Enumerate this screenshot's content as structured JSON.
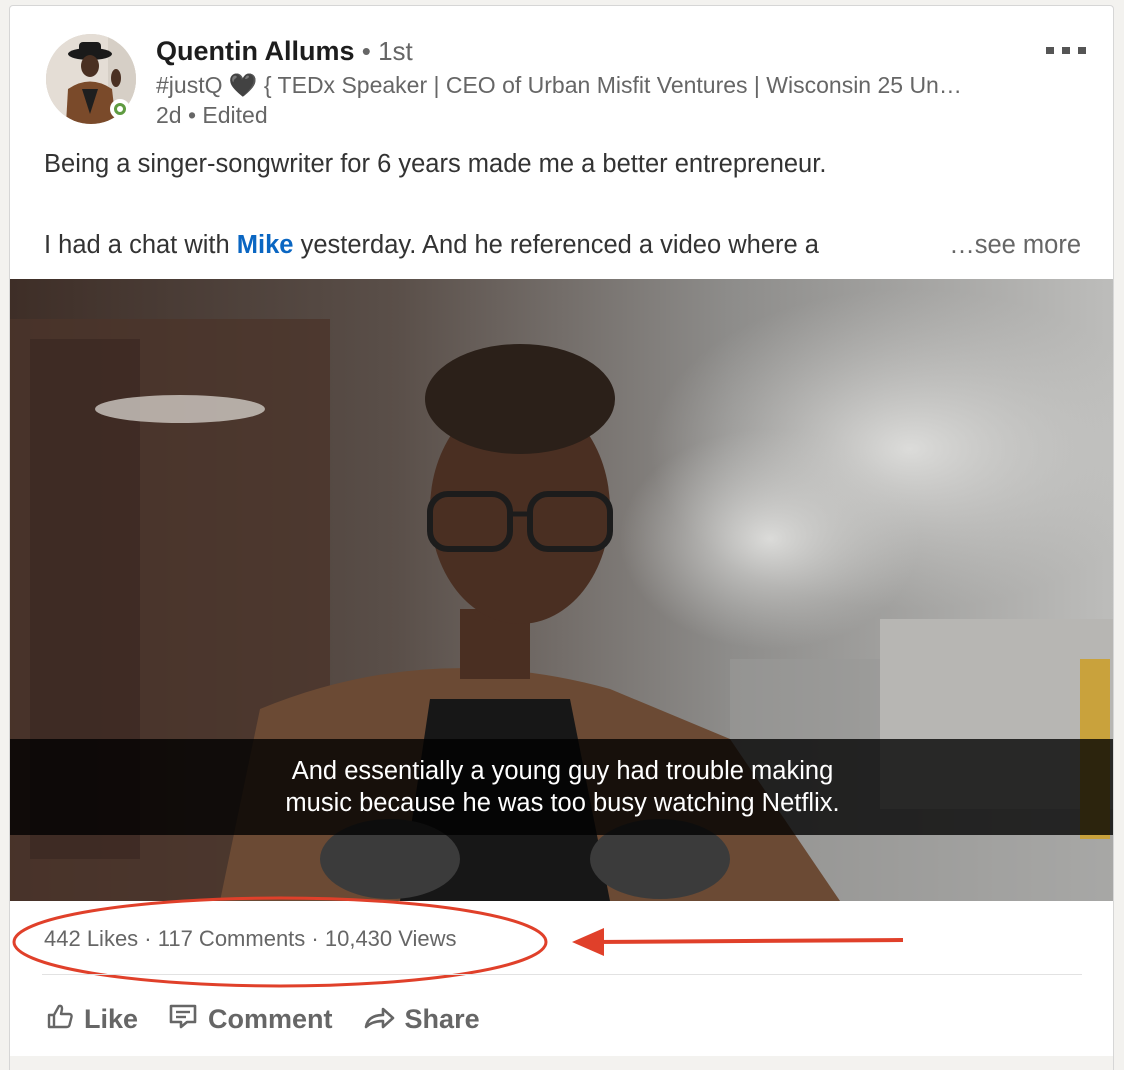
{
  "post": {
    "author": {
      "name": "Quentin Allums",
      "degree": " • 1st",
      "headline": "#justQ 🖤  { TEDx Speaker | CEO of Urban Misfit Ventures | Wisconsin 25 Un…",
      "meta": "2d • Edited",
      "online_status_color": "#5f9b41"
    },
    "text": {
      "line1": "Being a singer-songwriter for 6 years made me a better entrepreneur.",
      "line2_before": "I had a chat with ",
      "mention": "Mike",
      "line2_after": " yesterday. And he referenced a video where a",
      "see_more": "…see more"
    },
    "video": {
      "caption_line1": "And essentially a young guy had trouble making",
      "caption_line2": "music because he was too busy watching Netflix."
    },
    "social_counts": {
      "likes": "442 Likes",
      "sep1": " · ",
      "comments": "117 Comments",
      "sep2": " · ",
      "views": "10,430 Views"
    },
    "actions": {
      "like": "Like",
      "comment": "Comment",
      "share": "Share"
    },
    "annotation_color": "#e0402a"
  }
}
